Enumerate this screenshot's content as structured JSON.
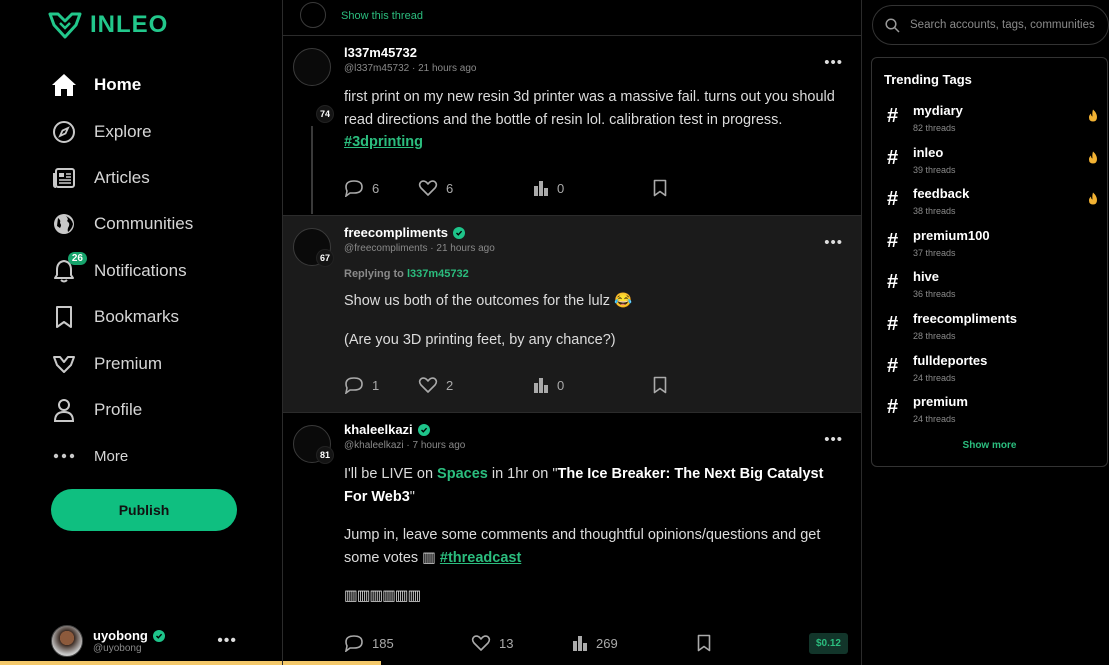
{
  "brand": {
    "name": "INLEO",
    "accent": "#22c78b"
  },
  "nav": {
    "items": [
      {
        "label": "Home",
        "icon": "home-icon"
      },
      {
        "label": "Explore",
        "icon": "compass-icon"
      },
      {
        "label": "Articles",
        "icon": "newspaper-icon"
      },
      {
        "label": "Communities",
        "icon": "globe-icon"
      },
      {
        "label": "Notifications",
        "icon": "bell-icon",
        "badge": "26"
      },
      {
        "label": "Bookmarks",
        "icon": "bookmark-icon"
      },
      {
        "label": "Premium",
        "icon": "premium-icon"
      },
      {
        "label": "Profile",
        "icon": "user-icon"
      },
      {
        "label": "More",
        "icon": "more-dots-icon"
      }
    ],
    "publish_label": "Publish"
  },
  "current_user": {
    "name": "uyobong",
    "handle": "@uyobong"
  },
  "feed": {
    "show_thread": "Show this thread",
    "posts": [
      {
        "author": "l337m45732",
        "handle": "@l337m45732",
        "time": "21 hours ago",
        "reputation": "74",
        "text1": "first print on my new resin 3d printer was a massive fail. turns out you should read directions and the bottle of resin lol. calibration test in progress.",
        "tag": "#3dprinting",
        "comments": "6",
        "likes": "6",
        "views": "0"
      },
      {
        "author": "freecompliments",
        "handle": "@freecompliments",
        "time": "21 hours ago",
        "reputation": "67",
        "replying_label": "Replying to",
        "replying_to": "l337m45732",
        "text1": "Show us both of the outcomes for the lulz 😂",
        "text2": "(Are you 3D printing feet, by any chance?)",
        "comments": "1",
        "likes": "2",
        "views": "0"
      },
      {
        "author": "khaleelkazi",
        "handle": "@khaleelkazi",
        "time": "7 hours ago",
        "reputation": "81",
        "text_a": "I'll be LIVE on ",
        "text_spaces": "Spaces",
        "text_b": " in 1hr on \"",
        "text_title": "The Ice Breaker: The Next Big Catalyst For Web3",
        "text_c": "\"",
        "text2": "Jump in, leave some comments and thoughtful opinions/questions and get some votes ",
        "text2_emoji": "▥",
        "tag": "#threadcast",
        "text3": "▥▥▥▥▥▥",
        "comments": "185",
        "likes": "13",
        "views": "269",
        "payout": "$0.12"
      }
    ]
  },
  "search": {
    "placeholder": "Search accounts, tags, communities"
  },
  "trending": {
    "title": "Trending Tags",
    "tags": [
      {
        "name": "mydiary",
        "count": "82 threads",
        "hot": true
      },
      {
        "name": "inleo",
        "count": "39 threads",
        "hot": true
      },
      {
        "name": "feedback",
        "count": "38 threads",
        "hot": true
      },
      {
        "name": "premium100",
        "count": "37 threads",
        "hot": false
      },
      {
        "name": "hive",
        "count": "36 threads",
        "hot": false
      },
      {
        "name": "freecompliments",
        "count": "28 threads",
        "hot": false
      },
      {
        "name": "fulldeportes",
        "count": "24 threads",
        "hot": false
      },
      {
        "name": "premium",
        "count": "24 threads",
        "hot": false
      }
    ],
    "show_more": "Show more"
  }
}
